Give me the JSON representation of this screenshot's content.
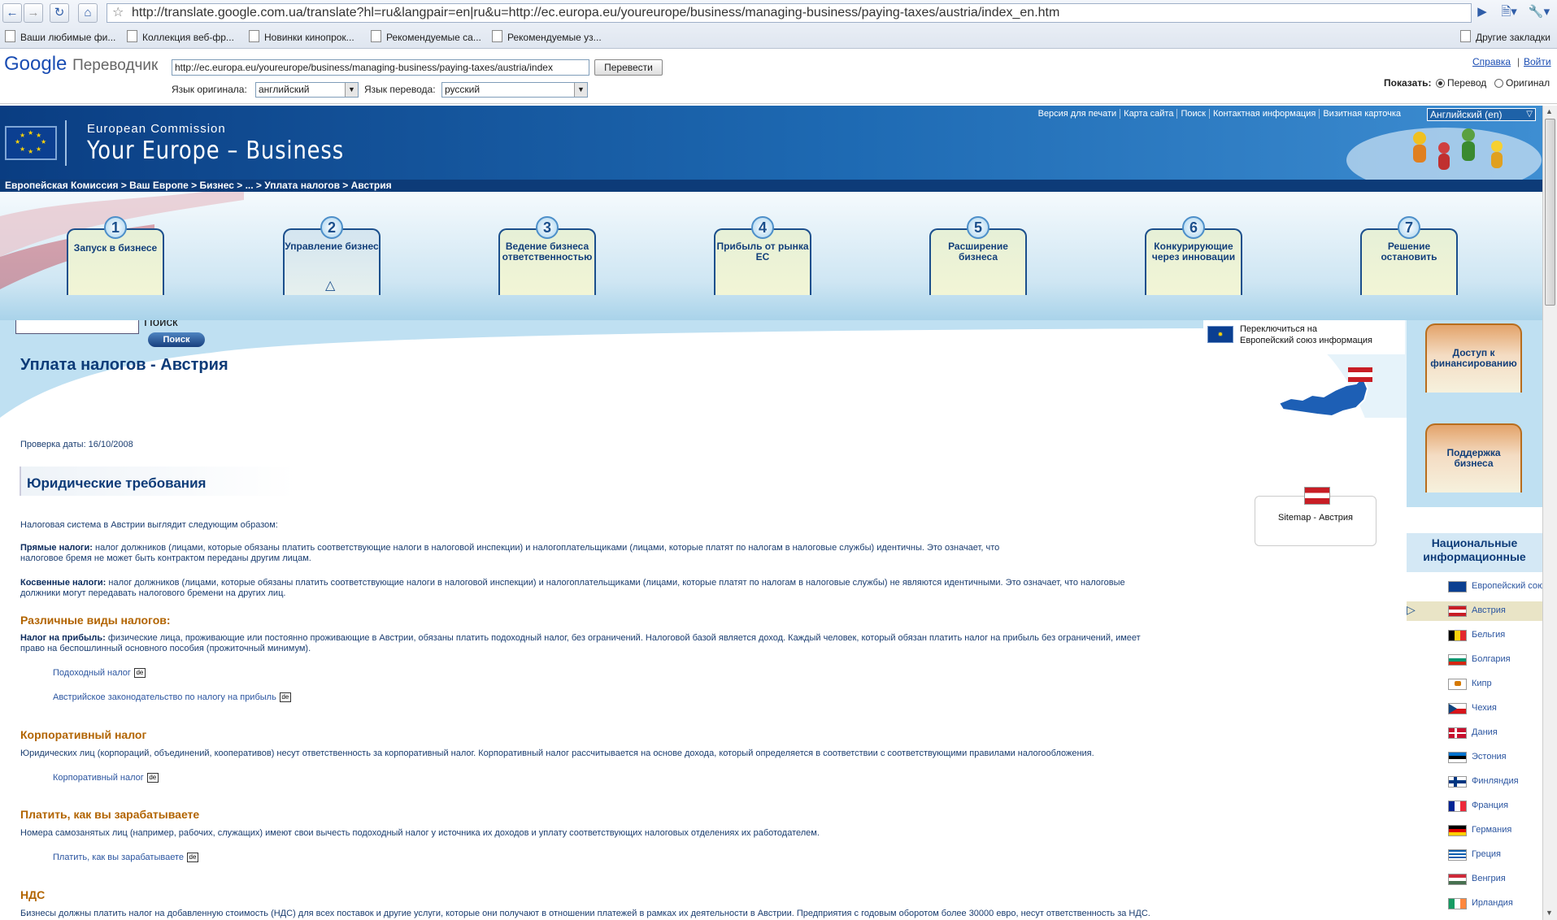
{
  "browser": {
    "url": "http://translate.google.com.ua/translate?hl=ru&langpair=en|ru&u=http://ec.europa.eu/youreurope/business/managing-business/paying-taxes/austria/index_en.htm",
    "bookmarks": [
      "Ваши любимые фи...",
      "Коллекция веб-фр...",
      "Новинки кинопрок...",
      "Рекомендуемые са...",
      "Рекомендуемые уз..."
    ],
    "other_bookmarks": "Другие закладки"
  },
  "translate_bar": {
    "logo_google": "Google",
    "logo_product": "Переводчик",
    "url_value": "http://ec.europa.eu/youreurope/business/managing-business/paying-taxes/austria/index",
    "translate_button": "Перевести",
    "source_label": "Язык оригинала:",
    "source_value": "английский",
    "target_label": "Язык перевода:",
    "target_value": "русский",
    "help_link": "Справка",
    "login_link": "Войти",
    "show_label": "Показать:",
    "show_translation": "Перевод",
    "show_original": "Оригинал"
  },
  "ec_header": {
    "org": "European Commission",
    "site": "Your Europe – Business",
    "top_links": [
      "Версия для печати",
      "Карта сайта",
      "Поиск",
      "Контактная информация",
      "Визитная карточка"
    ],
    "language": "Английский (en)"
  },
  "breadcrumb": "Европейская Комиссия  > Ваш Европе  > Бизнес  > ...  > Уплата налогов  > Австрия",
  "steps": [
    {
      "num": "1",
      "label": "Запуск в бизнесе"
    },
    {
      "num": "2",
      "label": "Управление бизнес"
    },
    {
      "num": "3",
      "label": "Ведение бизнеса ответственностью"
    },
    {
      "num": "4",
      "label": "Прибыль от рынка ЕС"
    },
    {
      "num": "5",
      "label": "Расширение бизнеса"
    },
    {
      "num": "6",
      "label": "Конкурирующие через инновации"
    },
    {
      "num": "7",
      "label": "Решение остановить"
    }
  ],
  "search": {
    "label": "Поиск",
    "button": "Поиск"
  },
  "page": {
    "title": "Уплата налогов - Австрия",
    "date": "Проверка даты: 16/10/2008",
    "section": "Юридические требования",
    "intro": "Налоговая система в Австрии выглядит следующим образом:",
    "direct_label": "Прямые налоги:",
    "direct_text1": "налог должников (лицами, которые обязаны платить соответствующие налоги в налоговой инспекции) и налогоплательщиками (лицами, которые платят по налогам в налоговые службы) идентичны. Это означает, что",
    "direct_text2": "налоговое бремя не может быть контрактом переданы другим лицам.",
    "indirect_label": "Косвенные налоги:",
    "indirect_text1": "налог должников (лицами, которые обязаны платить соответствующие налоги в налоговой инспекции) и налогоплательщиками (лицами, которые платят по налогам в налоговые службы) не являются идентичными. Это означает, что налоговые",
    "indirect_text2": "должники могут передавать налогового бремени на других лиц.",
    "types_heading": "Различные виды налогов:",
    "profit_label": "Налог на прибыль:",
    "profit_text1": "физические лица, проживающие или постоянно проживающие в Австрии, обязаны платить подоходный налог, без ограничений. Налоговой базой является доход. Каждый человек, который обязан платить налог на прибыль без ограничений, имеет",
    "profit_text2": "право на беспошлинный основного пособия (прожиточный минимум).",
    "link_income": "Подоходный налог",
    "link_law": "Австрийское законодательство по налогу на прибыль",
    "corp_heading": "Корпоративный налог",
    "corp_text": "Юридических лиц (корпораций, объединений, кооперативов) несут ответственность за корпоративный налог. Корпоративный налог рассчитывается на основе дохода, который определяется в соответствии с соответствующими правилами налогообложения.",
    "link_corp": "Корпоративный налог",
    "paye_heading": "Платить, как вы зарабатываете",
    "paye_text": "Номера самозанятых лиц (например, рабочих, служащих) имеют свои вычесть подоходный налог у источника их доходов и уплату соответствующих налоговых отделениях их работодателем.",
    "link_paye": "Платить, как вы зарабатываете",
    "vat_heading": "НДС",
    "vat_text": "Бизнесы должны платить налог на добавленную стоимость (НДС) для всех поставок и другие услуги, которые они получают в отношении платежей в рамках их деятельности в Австрии. Предприятия с годовым оборотом более 30000 евро, несут ответственность за НДС.",
    "de_badge": "de"
  },
  "switch_box": {
    "line1": "Переключиться на",
    "line2": "Европейский союз информация"
  },
  "sitemap_box": "Sitemap - Австрия",
  "sidebar": {
    "btn1": "Доступ к финансированию",
    "btn2": "Поддержка бизнеса",
    "nat_heading": "Национальные информационные",
    "countries": [
      "Европейский союз",
      "Австрия",
      "Бельгия",
      "Болгария",
      "Кипр",
      "Чехия",
      "Дания",
      "Эстония",
      "Финляндия",
      "Франция",
      "Германия",
      "Греция",
      "Венгрия",
      "Ирландия"
    ]
  },
  "colors": {
    "ec_blue": "#0d3b78",
    "accent_orange": "#b26400",
    "link_blue": "#2b55a0"
  }
}
